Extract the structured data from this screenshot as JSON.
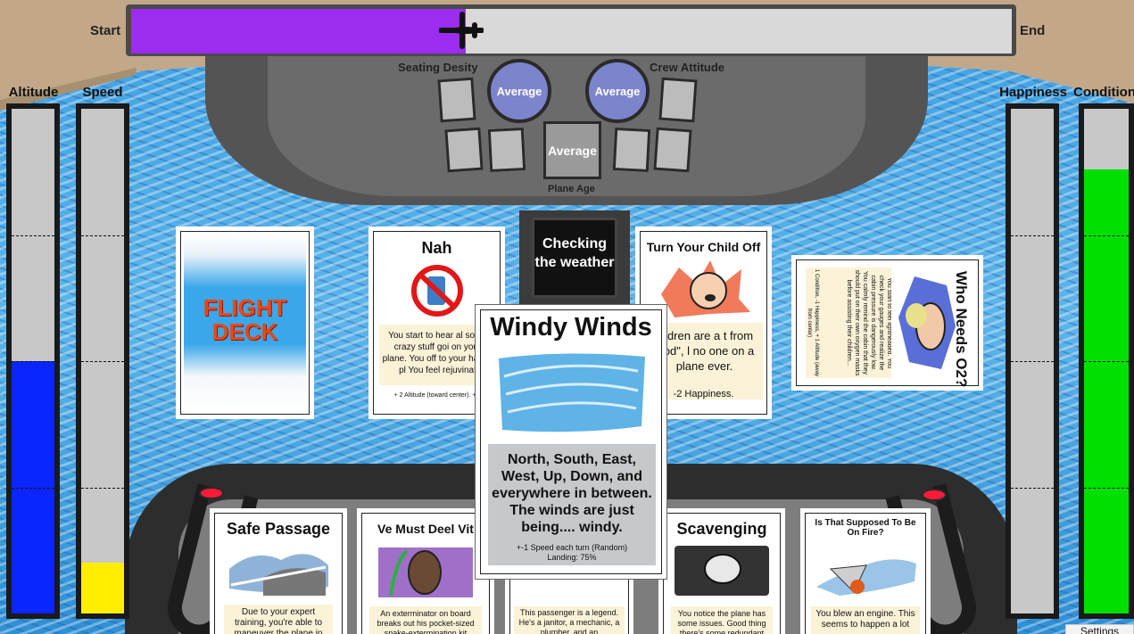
{
  "journey": {
    "start_label": "Start",
    "end_label": "End",
    "progress": 0.38
  },
  "gauges": {
    "altitude": {
      "label": "Altitude",
      "level": 0.5,
      "color": "#0a25ff"
    },
    "speed": {
      "label": "Speed",
      "level": 0.1,
      "color": "#ffee00"
    },
    "happiness": {
      "label": "Happiness",
      "level": 0.0,
      "color": "#00e000"
    },
    "condition": {
      "label": "Condition",
      "level": 0.88,
      "color": "#00e000"
    }
  },
  "console": {
    "seating_density_label": "Seating Desity",
    "seating_density_value": "Average",
    "crew_attitude_label": "Crew Attitude",
    "crew_attitude_value": "Average",
    "plane_age_label": "Plane Age",
    "plane_age_value": "Average"
  },
  "status": {
    "text": "Checking the weather"
  },
  "deck": {
    "title_line1": "FLIGHT",
    "title_line2": "DECK"
  },
  "cards": {
    "nah": {
      "title": "Nah",
      "text": "You start to hear al some crazy stuff goi on your plane. You off to your happy pl You feel rejuvinat",
      "effect": "+ 2 Altitude (toward center). +1"
    },
    "turn_child": {
      "title": "Turn Your Child Off",
      "text": "hildren are a t from God\", l no one on a plane ever.",
      "effect": "-2 Happiness."
    },
    "o2": {
      "title": "Who Needs O2?",
      "text": "You start to feel lightheaded. You check your gauges and realize the cabin pressure is dangerously low. You calmly remind the cabin that they should put on their own oxygen masks before assisting their children...",
      "effect": "1 Condition, -1 Happiness, + 1 Altitude (away from center)"
    },
    "windy": {
      "title": "Windy Winds",
      "text": "North, South, East, West, Up, Down, and everywhere in between. The winds are just being.... windy.",
      "effect": "+-1 Speed each turn (Random)",
      "landing": "Landing: 75%"
    },
    "safe_passage": {
      "title": "Safe Passage",
      "text": "Due to your expert training, you're able to maneuver the plane in"
    },
    "deel_vit": {
      "title": "Ve Must Deel Vit",
      "text": "An exterminator on board breaks out his pocket-sized snake-extermination kit"
    },
    "legend": {
      "text": "This passenger is a legend. He's a janitor, a mechanic, a plumber, and an"
    },
    "scavenging": {
      "title": "Scavenging",
      "text": "You notice the plane has some issues. Good thing there's some redundant"
    },
    "on_fire": {
      "title": "Is That Supposed To Be On Fire?",
      "text": "You blew an engine. This seems to happen a lot"
    }
  },
  "settings_label": "Settings"
}
